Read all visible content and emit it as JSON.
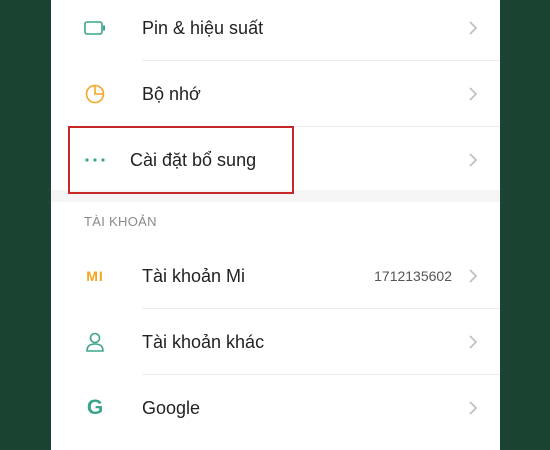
{
  "settings_items": [
    {
      "label": "Pin & hiệu suất",
      "icon": "battery-icon"
    },
    {
      "label": "Bộ nhớ",
      "icon": "storage-pie-icon"
    },
    {
      "label": "Cài đặt bổ sung",
      "icon": "more-dots-icon"
    }
  ],
  "accounts_section": {
    "header": "TÀI KHOẢN",
    "items": [
      {
        "label": "Tài khoản Mi",
        "value": "1712135602",
        "icon": "mi-logo-icon"
      },
      {
        "label": "Tài khoản khác",
        "icon": "person-icon"
      },
      {
        "label": "Google",
        "icon": "google-g-icon"
      }
    ]
  },
  "mi_logo_text": "MI",
  "google_logo_text": "G",
  "colors": {
    "accent_teal": "#3aa58a",
    "accent_orange": "#f5a623",
    "highlight_red": "#c62828",
    "background_green": "#1b4332"
  }
}
